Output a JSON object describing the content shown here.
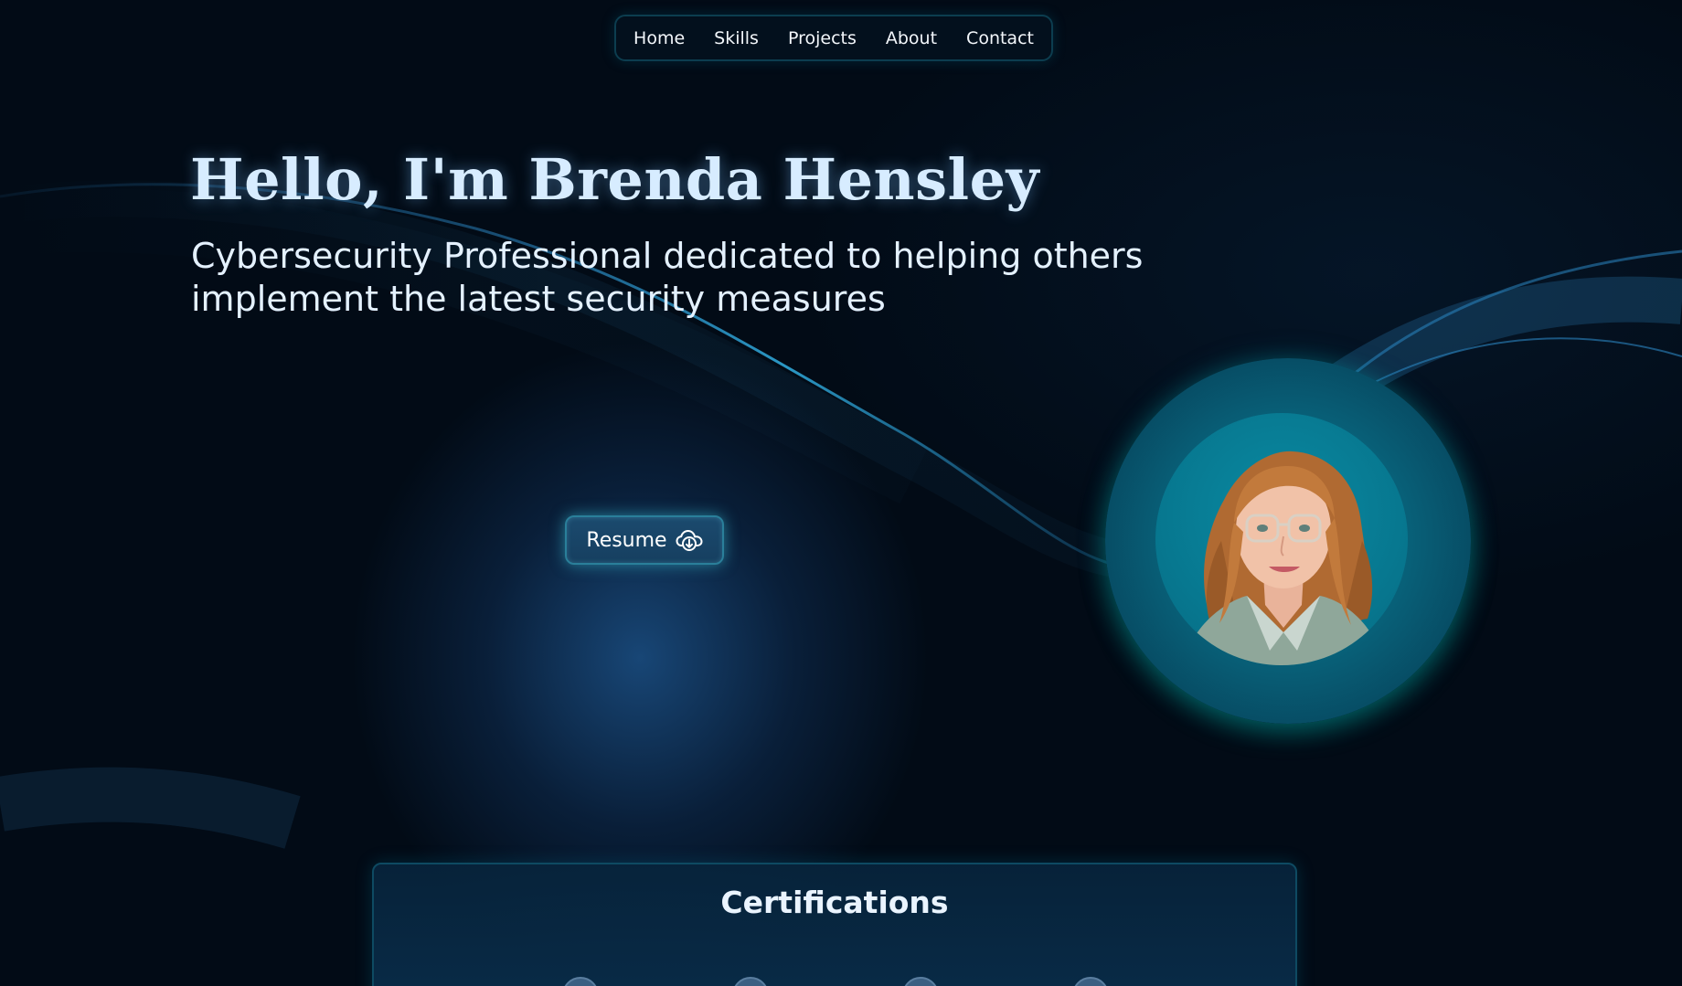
{
  "nav": {
    "items": [
      {
        "label": "Home"
      },
      {
        "label": "Skills"
      },
      {
        "label": "Projects"
      },
      {
        "label": "About"
      },
      {
        "label": "Contact"
      }
    ]
  },
  "hero": {
    "title": "Hello, I'm Brenda Hensley",
    "subtitle": "Cybersecurity Professional dedicated to helping others implement the latest security measures",
    "resume_label": "Resume",
    "resume_icon": "cloud-download-icon"
  },
  "avatar": {
    "icon": "profile-photo"
  },
  "certifications": {
    "title": "Certifications",
    "badge_icon": "certification-badge-icon"
  },
  "colors": {
    "background": "#020b16",
    "accent": "#0a7f96",
    "glow": "#3cc8dc",
    "title": "#d7ecff"
  }
}
